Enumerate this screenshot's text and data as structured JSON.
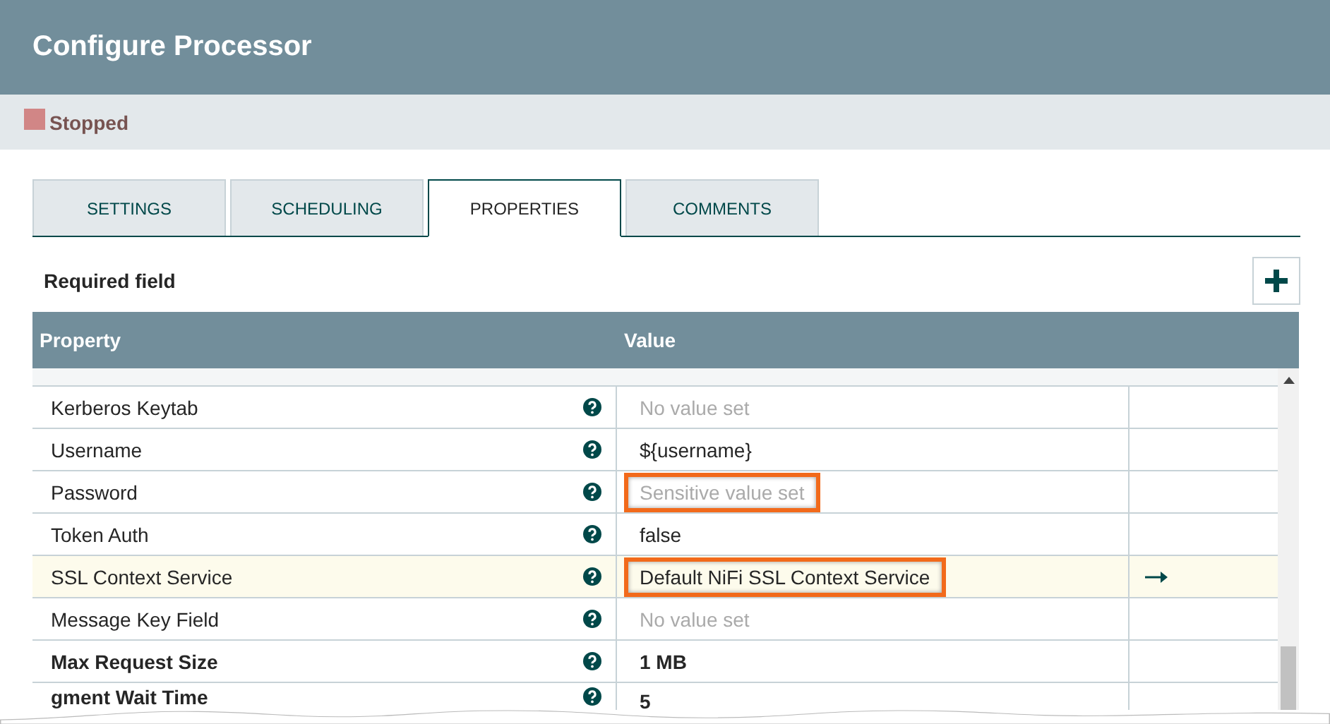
{
  "window": {
    "title": "Configure Processor"
  },
  "status": {
    "label": "Stopped",
    "color": "#d18686"
  },
  "tabs": [
    {
      "label": "SETTINGS",
      "selected": false
    },
    {
      "label": "SCHEDULING",
      "selected": false
    },
    {
      "label": "PROPERTIES",
      "selected": true
    },
    {
      "label": "COMMENTS",
      "selected": false
    }
  ],
  "required_field_label": "Required field",
  "table": {
    "columns": [
      "Property",
      "Value"
    ],
    "rows": [
      {
        "property": "Kerberos Keytab",
        "value": "No value set",
        "set": false,
        "required": false,
        "highlighted": false,
        "annotated": false,
        "goto": false,
        "kind": "row"
      },
      {
        "property": "Username",
        "value": "${username}",
        "set": true,
        "required": false,
        "highlighted": false,
        "annotated": false,
        "goto": false,
        "kind": "row"
      },
      {
        "property": "Password",
        "value": "Sensitive value set",
        "set": false,
        "required": false,
        "highlighted": false,
        "annotated": true,
        "goto": false,
        "kind": "row"
      },
      {
        "property": "Token Auth",
        "value": "false",
        "set": true,
        "required": false,
        "highlighted": false,
        "annotated": false,
        "goto": false,
        "kind": "row"
      },
      {
        "property": "SSL Context Service",
        "value": "Default NiFi SSL Context Service",
        "set": true,
        "required": false,
        "highlighted": true,
        "annotated": true,
        "goto": true,
        "kind": "row"
      },
      {
        "property": "Message Key Field",
        "value": "No value set",
        "set": false,
        "required": false,
        "highlighted": false,
        "annotated": false,
        "goto": false,
        "kind": "row"
      },
      {
        "property": "Max Request Size",
        "value": "1 MB",
        "set": true,
        "required": true,
        "highlighted": false,
        "annotated": false,
        "goto": false,
        "kind": "row"
      },
      {
        "property": "gment Wait Time",
        "value": "5",
        "set": true,
        "required": true,
        "highlighted": false,
        "annotated": false,
        "goto": false,
        "kind": "cut"
      }
    ]
  }
}
